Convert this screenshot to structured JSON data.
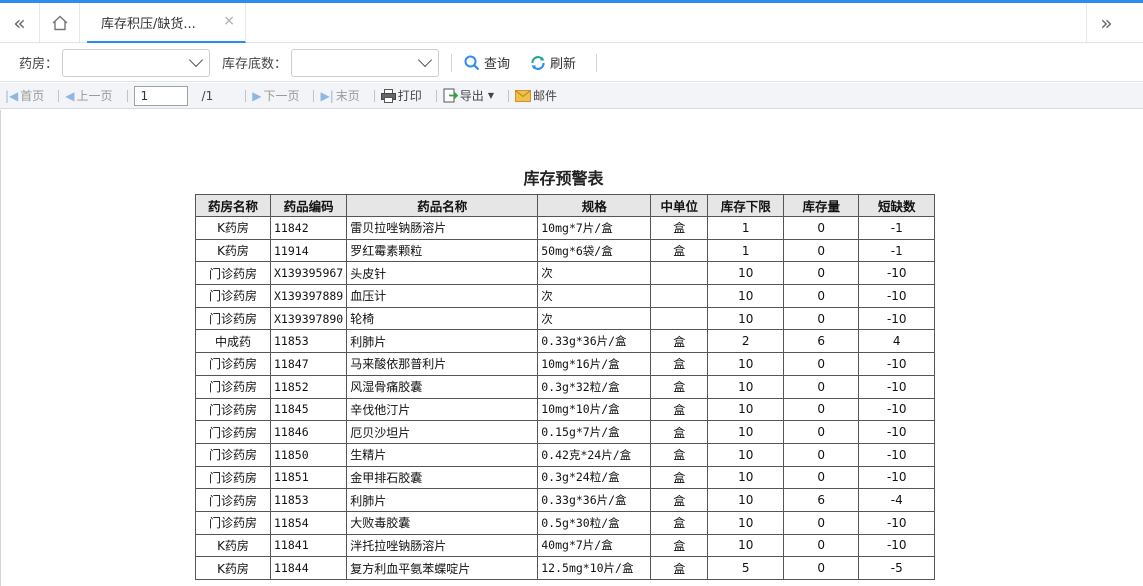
{
  "tabs": {
    "active_label": "库存积压/缺货..."
  },
  "filters": {
    "pharmacy_label": "药房：",
    "pharmacy_value": "",
    "stock_label": "库存底数：",
    "stock_value": "",
    "query_label": "查询",
    "refresh_label": "刷新"
  },
  "pager": {
    "first": "首页",
    "prev": "上一页",
    "page_value": "1",
    "total": "/1",
    "next": "下一页",
    "last": "末页",
    "print": "打印",
    "export": "导出",
    "mail": "邮件"
  },
  "report": {
    "title": "库存预警表",
    "columns": [
      "药房名称",
      "药品编码",
      "药品名称",
      "规格",
      "中单位",
      "库存下限",
      "库存量",
      "短缺数"
    ],
    "rows": [
      [
        "K药房",
        "11842",
        "雷贝拉唑钠肠溶片",
        "10mg*7片/盒",
        "盒",
        "1",
        "0",
        "-1"
      ],
      [
        "K药房",
        "11914",
        "罗红霉素颗粒",
        "50mg*6袋/盒",
        "盒",
        "1",
        "0",
        "-1"
      ],
      [
        "门诊药房",
        "X139395967",
        "头皮针",
        "次",
        "",
        "10",
        "0",
        "-10"
      ],
      [
        "门诊药房",
        "X139397889",
        "血压计",
        "次",
        "",
        "10",
        "0",
        "-10"
      ],
      [
        "门诊药房",
        "X139397890",
        "轮椅",
        "次",
        "",
        "10",
        "0",
        "-10"
      ],
      [
        "中成药",
        "11853",
        "利肺片",
        "0.33g*36片/盒",
        "盒",
        "2",
        "6",
        "4"
      ],
      [
        "门诊药房",
        "11847",
        "马来酸依那普利片",
        "10mg*16片/盒",
        "盒",
        "10",
        "0",
        "-10"
      ],
      [
        "门诊药房",
        "11852",
        "风湿骨痛胶囊",
        "0.3g*32粒/盒",
        "盒",
        "10",
        "0",
        "-10"
      ],
      [
        "门诊药房",
        "11845",
        "辛伐他汀片",
        "10mg*10片/盒",
        "盒",
        "10",
        "0",
        "-10"
      ],
      [
        "门诊药房",
        "11846",
        "厄贝沙坦片",
        "0.15g*7片/盒",
        "盒",
        "10",
        "0",
        "-10"
      ],
      [
        "门诊药房",
        "11850",
        "生精片",
        "0.42克*24片/盒",
        "盒",
        "10",
        "0",
        "-10"
      ],
      [
        "门诊药房",
        "11851",
        "金甲排石胶囊",
        "0.3g*24粒/盒",
        "盒",
        "10",
        "0",
        "-10"
      ],
      [
        "门诊药房",
        "11853",
        "利肺片",
        "0.33g*36片/盒",
        "盒",
        "10",
        "6",
        "-4"
      ],
      [
        "门诊药房",
        "11854",
        "大败毒胶囊",
        "0.5g*30粒/盒",
        "盒",
        "10",
        "0",
        "-10"
      ],
      [
        "K药房",
        "11841",
        "泮托拉唑钠肠溶片",
        "40mg*7片/盒",
        "盒",
        "10",
        "0",
        "-10"
      ],
      [
        "K药房",
        "11844",
        "复方利血平氨苯蝶啶片",
        "12.5mg*10片/盒",
        "盒",
        "5",
        "0",
        "-5"
      ]
    ]
  }
}
